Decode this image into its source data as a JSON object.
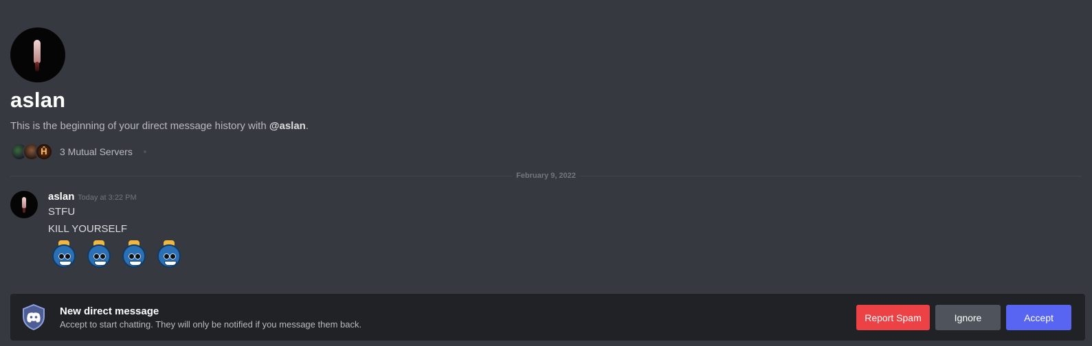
{
  "header": {
    "username": "aslan",
    "intro_prefix": "This is the beginning of your direct message history with ",
    "intro_handle": "@aslan",
    "intro_suffix": ".",
    "mutual_servers": "3 Mutual Servers"
  },
  "divider": {
    "date": "February 9, 2022"
  },
  "message": {
    "author": "aslan",
    "timestamp": "Today at 3:22 PM",
    "lines": [
      "STFU",
      "KILL YOURSELF"
    ],
    "emoji_count": 4,
    "emoji_name": "blue-grinning-bomb-emoji"
  },
  "request_bar": {
    "icon": "discord-shield-icon",
    "title": "New direct message",
    "subtitle": "Accept to start chatting. They will only be notified if you message them back.",
    "report_label": "Report Spam",
    "ignore_label": "Ignore",
    "accept_label": "Accept"
  },
  "colors": {
    "background": "#36393f",
    "bar_background": "#202225",
    "report": "#ed4245",
    "ignore": "#4f545c",
    "accept": "#5865f2"
  }
}
